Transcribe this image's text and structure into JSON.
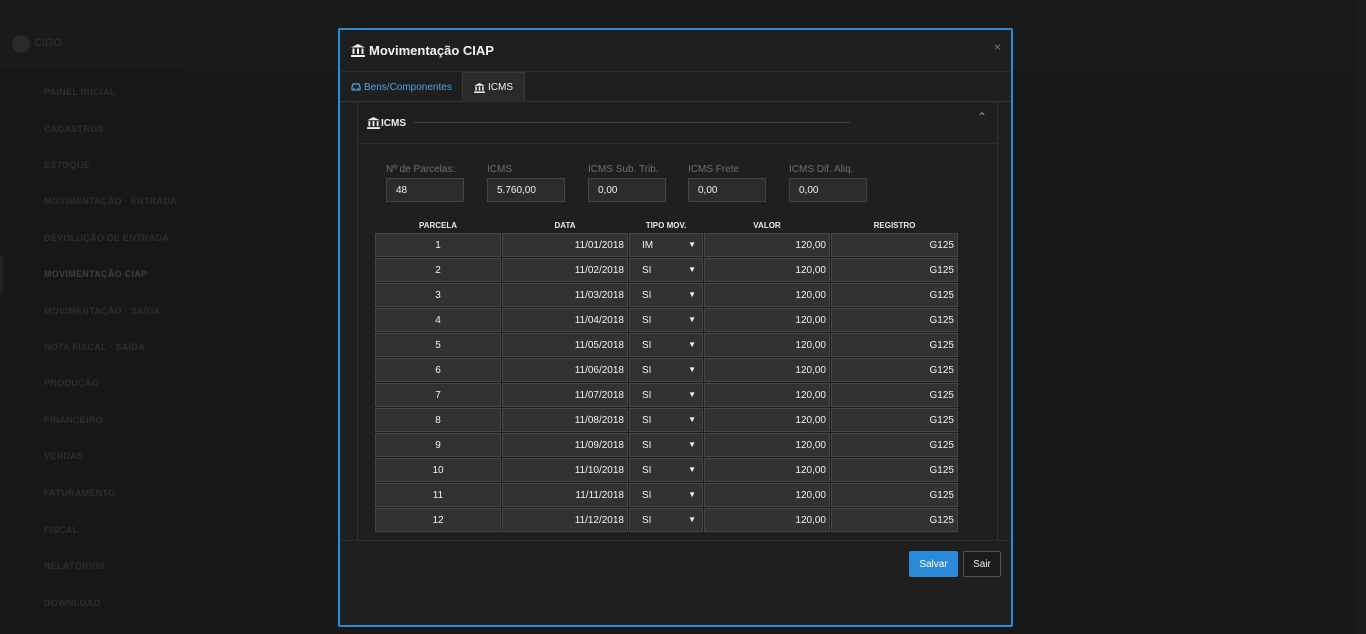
{
  "modal": {
    "title": "Movimentação CIAP",
    "close": "×",
    "title_icon": "bank-icon"
  },
  "tabs": [
    {
      "label": "Bens/Componentes",
      "icon": "car-icon"
    },
    {
      "label": "ICMS",
      "icon": "bank-icon"
    }
  ],
  "panel": {
    "title": "ICMS",
    "collapse": "⌃"
  },
  "fields": {
    "parcelas": {
      "label": "Nº de Parcelas:",
      "value": "48"
    },
    "icms": {
      "label": "ICMS",
      "value": "5.760,00"
    },
    "icms_sub": {
      "label": "ICMS Sub. Trib.",
      "value": "0,00"
    },
    "icms_frete": {
      "label": "ICMS Frete",
      "value": "0,00"
    },
    "icms_dif": {
      "label": "ICMS Dif. Aliq.",
      "value": "0,00"
    }
  },
  "grid": {
    "headers": {
      "parcela": "PARCELA",
      "data": "DATA",
      "tipo": "TIPO MOV.",
      "valor": "VALOR",
      "registro": "REGISTRO"
    },
    "rows": [
      {
        "parcela": "1",
        "data": "11/01/2018",
        "tipo": "IM",
        "valor": "120,00",
        "registro": "G125"
      },
      {
        "parcela": "2",
        "data": "11/02/2018",
        "tipo": "SI",
        "valor": "120,00",
        "registro": "G125"
      },
      {
        "parcela": "3",
        "data": "11/03/2018",
        "tipo": "SI",
        "valor": "120,00",
        "registro": "G125"
      },
      {
        "parcela": "4",
        "data": "11/04/2018",
        "tipo": "SI",
        "valor": "120,00",
        "registro": "G125"
      },
      {
        "parcela": "5",
        "data": "11/05/2018",
        "tipo": "SI",
        "valor": "120,00",
        "registro": "G125"
      },
      {
        "parcela": "6",
        "data": "11/06/2018",
        "tipo": "SI",
        "valor": "120,00",
        "registro": "G125"
      },
      {
        "parcela": "7",
        "data": "11/07/2018",
        "tipo": "SI",
        "valor": "120,00",
        "registro": "G125"
      },
      {
        "parcela": "8",
        "data": "11/08/2018",
        "tipo": "SI",
        "valor": "120,00",
        "registro": "G125"
      },
      {
        "parcela": "9",
        "data": "11/09/2018",
        "tipo": "SI",
        "valor": "120,00",
        "registro": "G125"
      },
      {
        "parcela": "10",
        "data": "11/10/2018",
        "tipo": "SI",
        "valor": "120,00",
        "registro": "G125"
      },
      {
        "parcela": "11",
        "data": "11/11/2018",
        "tipo": "SI",
        "valor": "120,00",
        "registro": "G125"
      },
      {
        "parcela": "12",
        "data": "11/12/2018",
        "tipo": "SI",
        "valor": "120,00",
        "registro": "G125"
      }
    ]
  },
  "buttons": {
    "save": "Salvar",
    "exit": "Sair"
  },
  "background": {
    "logo_text": "CIGO",
    "nav": [
      "PAINEL INICIAL",
      "CADASTROS",
      "ESTOQUE",
      "MOVIMENTAÇÃO · ENTRADA",
      "DEVOLUÇÃO DE ENTRADA",
      "MOVIMENTAÇÃO CIAP",
      "MOVIMENTAÇÃO · SAÍDA",
      "NOTA FISCAL · SAÍDA",
      "PRODUÇÃO",
      "FINANCEIRO",
      "VENDAS",
      "FATURAMENTO",
      "FISCAL",
      "RELATÓRIOS",
      "DOWNLOAD"
    ]
  },
  "colors": {
    "accent": "#2b8bd4",
    "modal_bg": "#1f1f1f",
    "cell_bg": "#323232",
    "save_button": "#2a8ad8"
  }
}
